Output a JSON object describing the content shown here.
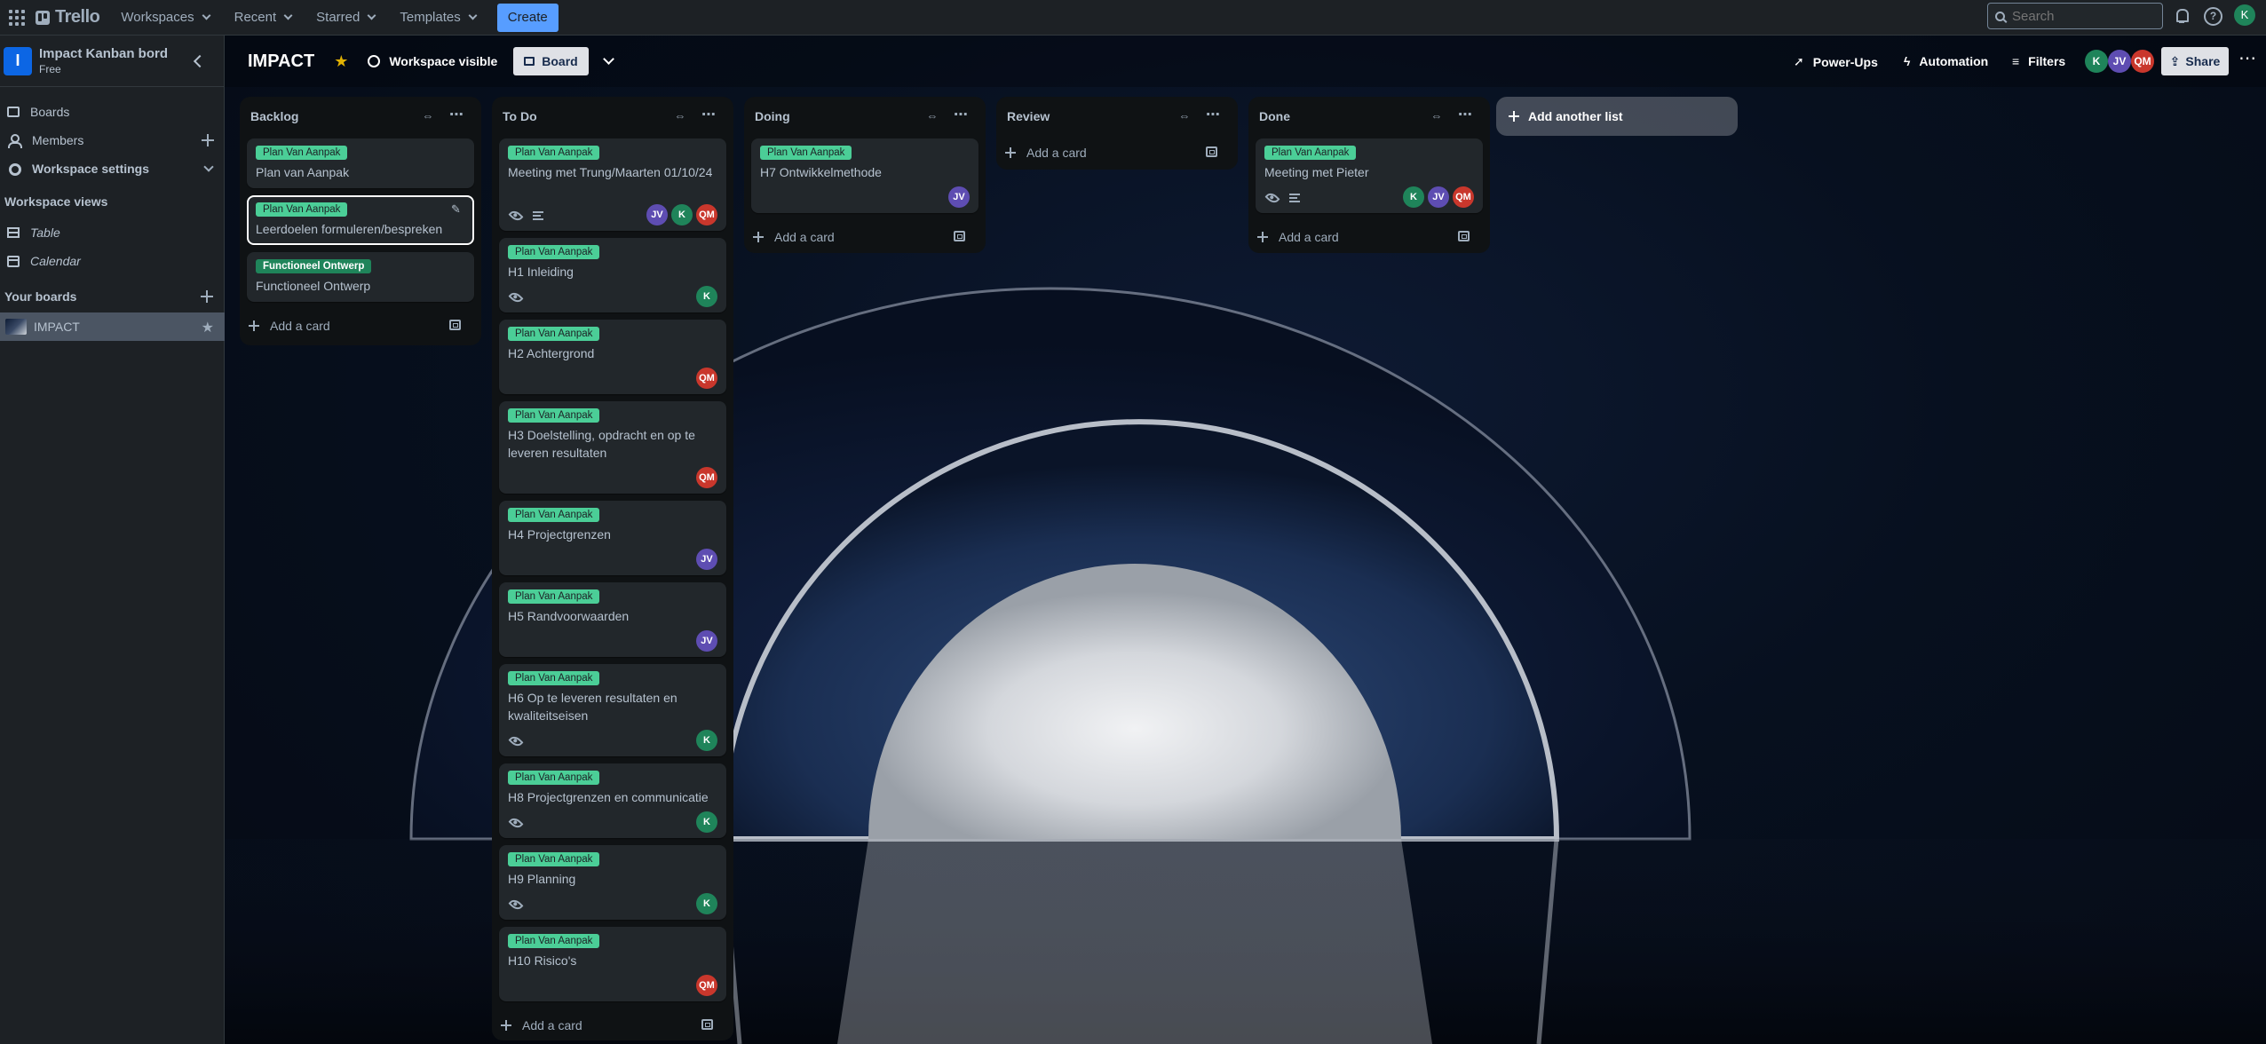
{
  "nav": {
    "logo": "Trello",
    "workspaces": "Workspaces",
    "recent": "Recent",
    "starred": "Starred",
    "templates": "Templates",
    "create": "Create",
    "search_placeholder": "Search",
    "user_initial": "K"
  },
  "sidebar": {
    "workspace_initial": "I",
    "workspace_name": "Impact Kanban bord",
    "workspace_plan": "Free",
    "items": [
      {
        "label": "Boards"
      },
      {
        "label": "Members"
      },
      {
        "label": "Workspace settings"
      }
    ],
    "views_title": "Workspace views",
    "views": [
      {
        "label": "Table"
      },
      {
        "label": "Calendar"
      }
    ],
    "your_boards_title": "Your boards",
    "boards": [
      {
        "label": "IMPACT"
      }
    ]
  },
  "board": {
    "title": "IMPACT",
    "visibility": "Workspace visible",
    "view": "Board",
    "power_ups": "Power-Ups",
    "automation": "Automation",
    "filters": "Filters",
    "members": [
      "K",
      "JV",
      "QM"
    ],
    "share": "Share",
    "add_list": "Add another list",
    "add_card": "Add a card"
  },
  "lists": [
    {
      "title": "Backlog",
      "cards": [
        {
          "label": "Plan Van Aanpak",
          "text": "Plan van Aanpak"
        },
        {
          "label": "Plan Van Aanpak",
          "text": "Leerdoelen formuleren/bespreken"
        },
        {
          "label": "Functioneel Ontwerp",
          "text": "Functioneel Ontwerp"
        }
      ]
    },
    {
      "title": "To Do",
      "cards": [
        {
          "label": "Plan Van Aanpak",
          "text": "Meeting met Trung/Maarten 01/10/24",
          "members": [
            "JV",
            "K",
            "QM"
          ]
        },
        {
          "label": "Plan Van Aanpak",
          "text": "H1 Inleiding",
          "members": [
            "K"
          ]
        },
        {
          "label": "Plan Van Aanpak",
          "text": "H2 Achtergrond",
          "members": [
            "QM"
          ]
        },
        {
          "label": "Plan Van Aanpak",
          "text": "H3 Doelstelling, opdracht en op te leveren resultaten",
          "members": [
            "QM"
          ]
        },
        {
          "label": "Plan Van Aanpak",
          "text": "H4 Projectgrenzen",
          "members": [
            "JV"
          ]
        },
        {
          "label": "Plan Van Aanpak",
          "text": "H5 Randvoorwaarden",
          "members": [
            "JV"
          ]
        },
        {
          "label": "Plan Van Aanpak",
          "text": "H6 Op te leveren resultaten en kwaliteitseisen",
          "members": [
            "K"
          ]
        },
        {
          "label": "Plan Van Aanpak",
          "text": "H8 Projectgrenzen en communicatie",
          "members": [
            "K"
          ]
        },
        {
          "label": "Plan Van Aanpak",
          "text": "H9 Planning",
          "members": [
            "K"
          ]
        },
        {
          "label": "Plan Van Aanpak",
          "text": "H10 Risico's",
          "members": [
            "QM"
          ]
        }
      ]
    },
    {
      "title": "Doing",
      "cards": [
        {
          "label": "Plan Van Aanpak",
          "text": "H7 Ontwikkelmethode",
          "members": [
            "JV"
          ]
        }
      ]
    },
    {
      "title": "Review",
      "cards": []
    },
    {
      "title": "Done",
      "cards": [
        {
          "label": "Plan Van Aanpak",
          "text": "Meeting met Pieter",
          "members": [
            "K",
            "JV",
            "QM"
          ]
        }
      ]
    }
  ],
  "colors": {
    "label_green": "#4bce97",
    "label_dark_green": "#1f845a",
    "create_blue": "#579dff",
    "star_yellow": "#e2b203",
    "avatar_k": "#1f845a",
    "avatar_jv": "#5e4db2",
    "avatar_qm": "#c9372c"
  }
}
